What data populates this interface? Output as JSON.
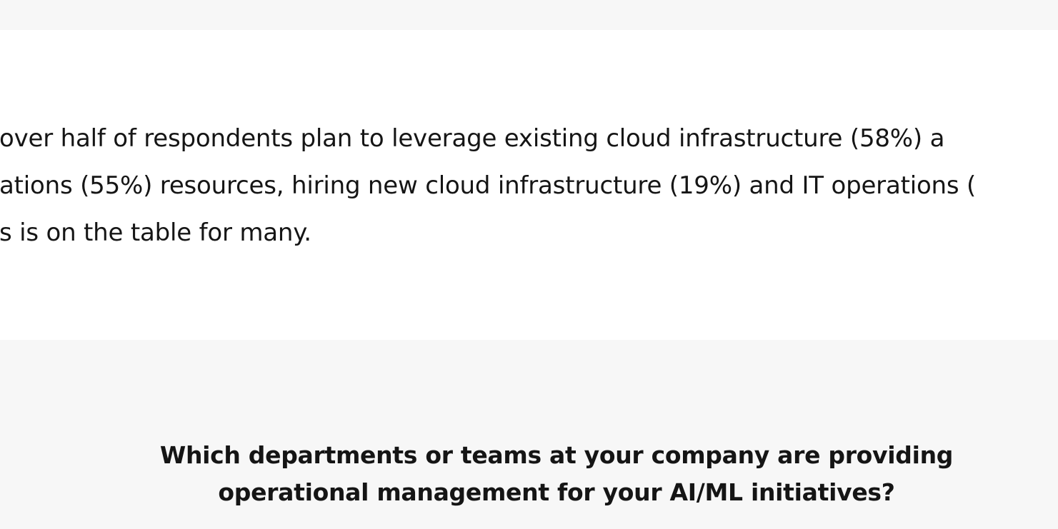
{
  "paragraph": {
    "lines": [
      " over half of respondents plan to leverage existing cloud infrastructure (58%) a",
      "ations (55%) resources, hiring new cloud infrastructure (19%) and IT operations (",
      "s is on the table for many."
    ]
  },
  "question": {
    "line1": "Which departments or teams at your company are providing",
    "line2": "operational management for your AI/ML initiatives?"
  },
  "colors": {
    "band_background": "#f7f7f7",
    "page_background": "#ffffff",
    "text": "#151515"
  }
}
